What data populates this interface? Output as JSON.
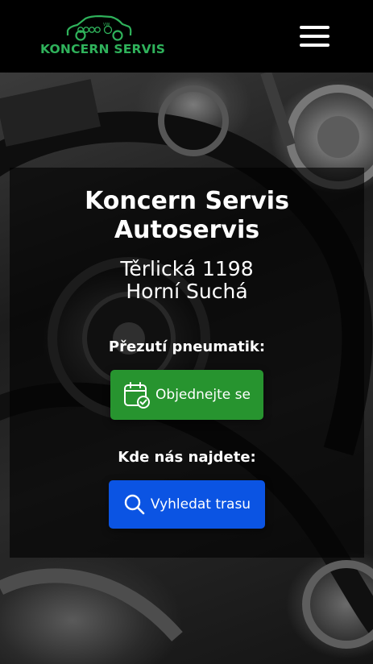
{
  "header": {
    "logo_text": "KONCERN SERVIS",
    "logo_icon": "car-logo-icon",
    "menu_icon": "hamburger-menu-icon",
    "accent_color": "#2fb25b"
  },
  "hero": {
    "title_line1": "Koncern Servis",
    "title_line2": "Autoservis",
    "address_line1": "Těrlická 1198",
    "address_line2": "Horní Suchá",
    "booking": {
      "label": "Přezutí pneumatik:",
      "button_label": "Objednejte se",
      "icon": "calendar-check-icon",
      "color": "#27942f"
    },
    "directions": {
      "label": "Kde nás najdete:",
      "button_label": "Vyhledat trasu",
      "icon": "search-icon",
      "color": "#0b54e3"
    }
  }
}
